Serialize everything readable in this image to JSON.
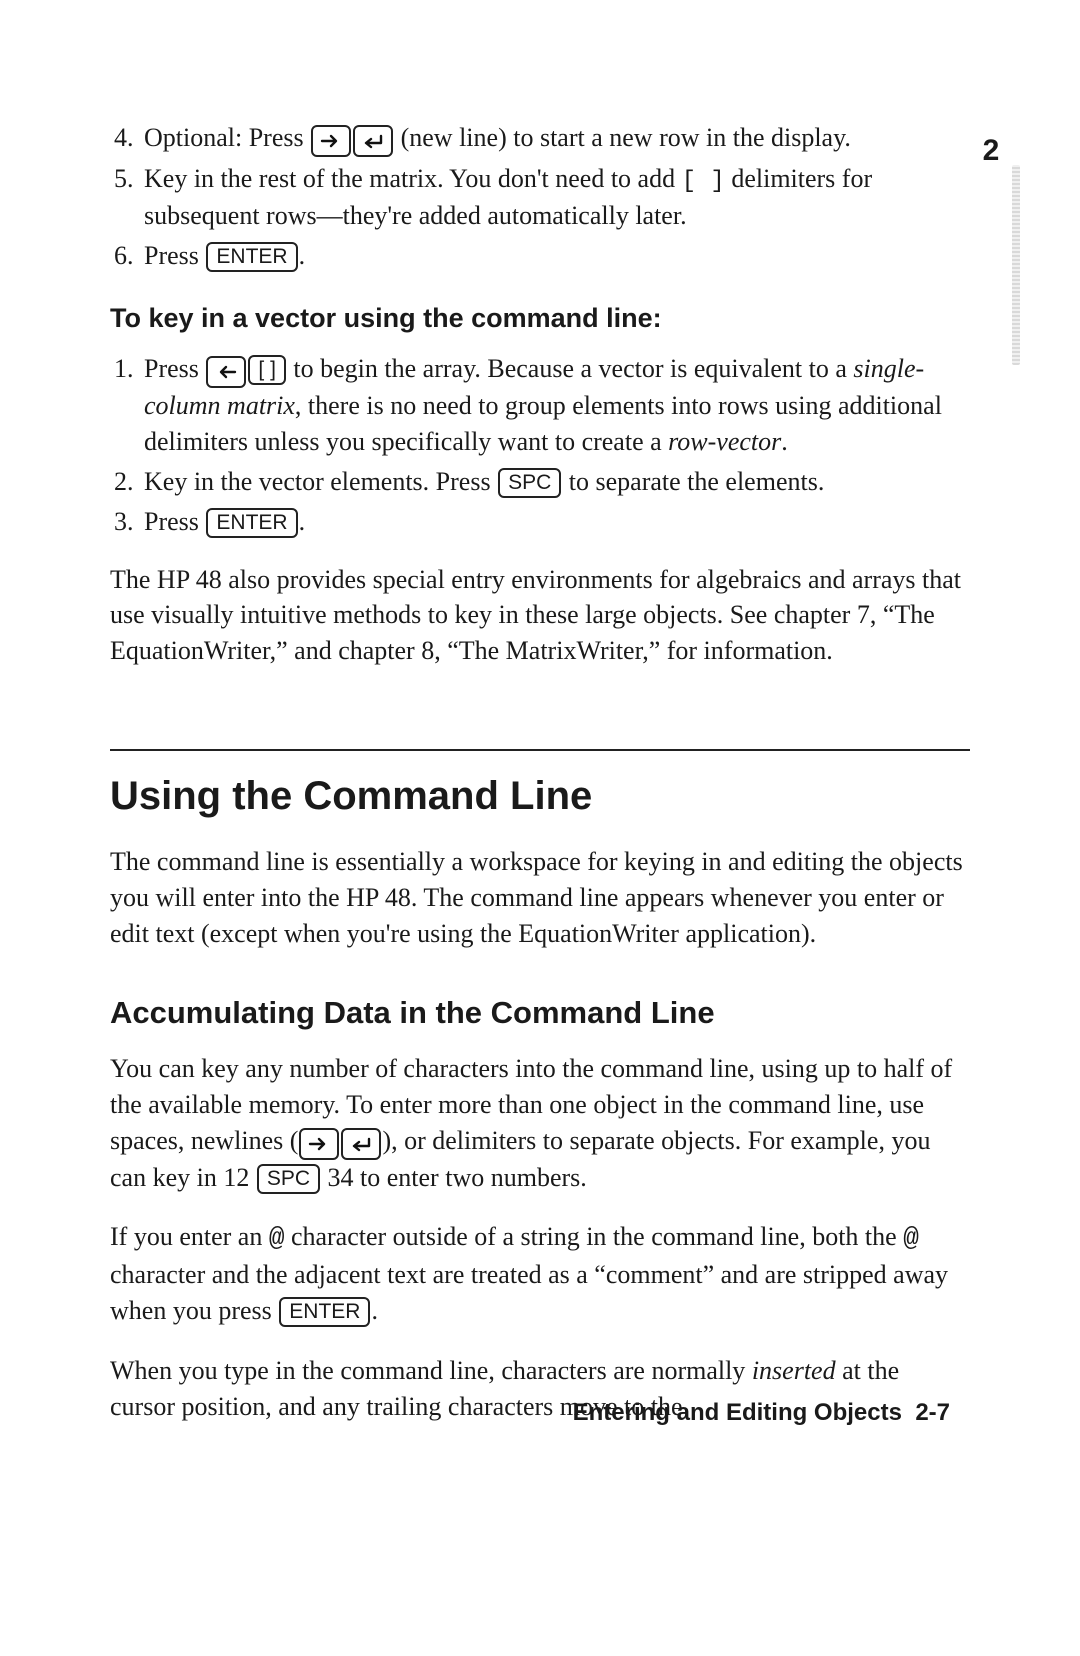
{
  "page_tab_number": "2",
  "list_a": {
    "start": 4,
    "items": [
      {
        "pre": "Optional: Press ",
        "keys": [
          "right-shift",
          "newline"
        ],
        "mid": " (new line) to start a new row in the display.",
        "post": ""
      },
      {
        "pre": "Key in the rest of the matrix. You don't need to add ",
        "bracket": "[ ]",
        "mid": " delimiters for subsequent rows—they're added automatically later.",
        "post": ""
      },
      {
        "pre": "Press ",
        "key_label": "ENTER",
        "post": "."
      }
    ]
  },
  "heading_vector": "To key in a vector using the command line:",
  "list_b": {
    "start": 1,
    "items": [
      {
        "pre": "Press ",
        "keys": [
          "left-shift",
          "brackets"
        ],
        "mid1": " to begin the array. Because a vector is equivalent to a ",
        "ital1": "single-column matrix",
        "mid2": ", there is no need to group elements into rows using additional delimiters unless you specifically want to create a ",
        "ital2": "row-vector",
        "post": "."
      },
      {
        "pre": "Key in the vector elements. Press ",
        "key_label": "SPC",
        "post": " to separate the elements."
      },
      {
        "pre": "Press ",
        "key_label": "ENTER",
        "post": "."
      }
    ]
  },
  "para_after_lists": "The HP 48 also provides special entry environments for algebraics and arrays that use visually intuitive methods to key in these large objects. See chapter 7, “The EquationWriter,” and chapter 8, “The MatrixWriter,” for information.",
  "section_title": "Using the Command Line",
  "section_intro": "The command line is essentially a workspace for keying in and editing the objects you will enter into the HP 48. The command line appears whenever you enter or edit text (except when you're using the EquationWriter application).",
  "subsection_title": "Accumulating Data in the Command Line",
  "sub_para1": {
    "pre": "You can key any number of characters into the command line, using up to half of the available memory. To enter more than one object in the command line, use spaces, newlines (",
    "keys": [
      "right-shift",
      "newline"
    ],
    "mid": "), or delimiters to separate objects. For example, you can key in 12 ",
    "key_label": "SPC",
    "post": " 34 to enter two numbers."
  },
  "sub_para2": {
    "pre": "If you enter an ",
    "at1": "@",
    "mid1": " character outside of a string in the command line, both the ",
    "at2": "@",
    "mid2": " character and the adjacent text are treated as a “comment” and are stripped away when you press ",
    "key_label": "ENTER",
    "post": "."
  },
  "sub_para3": {
    "pre": "When you type in the command line, characters are normally ",
    "ital": "inserted",
    "post": " at the cursor position, and any trailing characters move to the"
  },
  "footer": {
    "title": "Entering and Editing Objects",
    "page": "2-7"
  },
  "key_labels": {
    "enter": "ENTER",
    "spc": "SPC",
    "brackets": "[ ]"
  }
}
